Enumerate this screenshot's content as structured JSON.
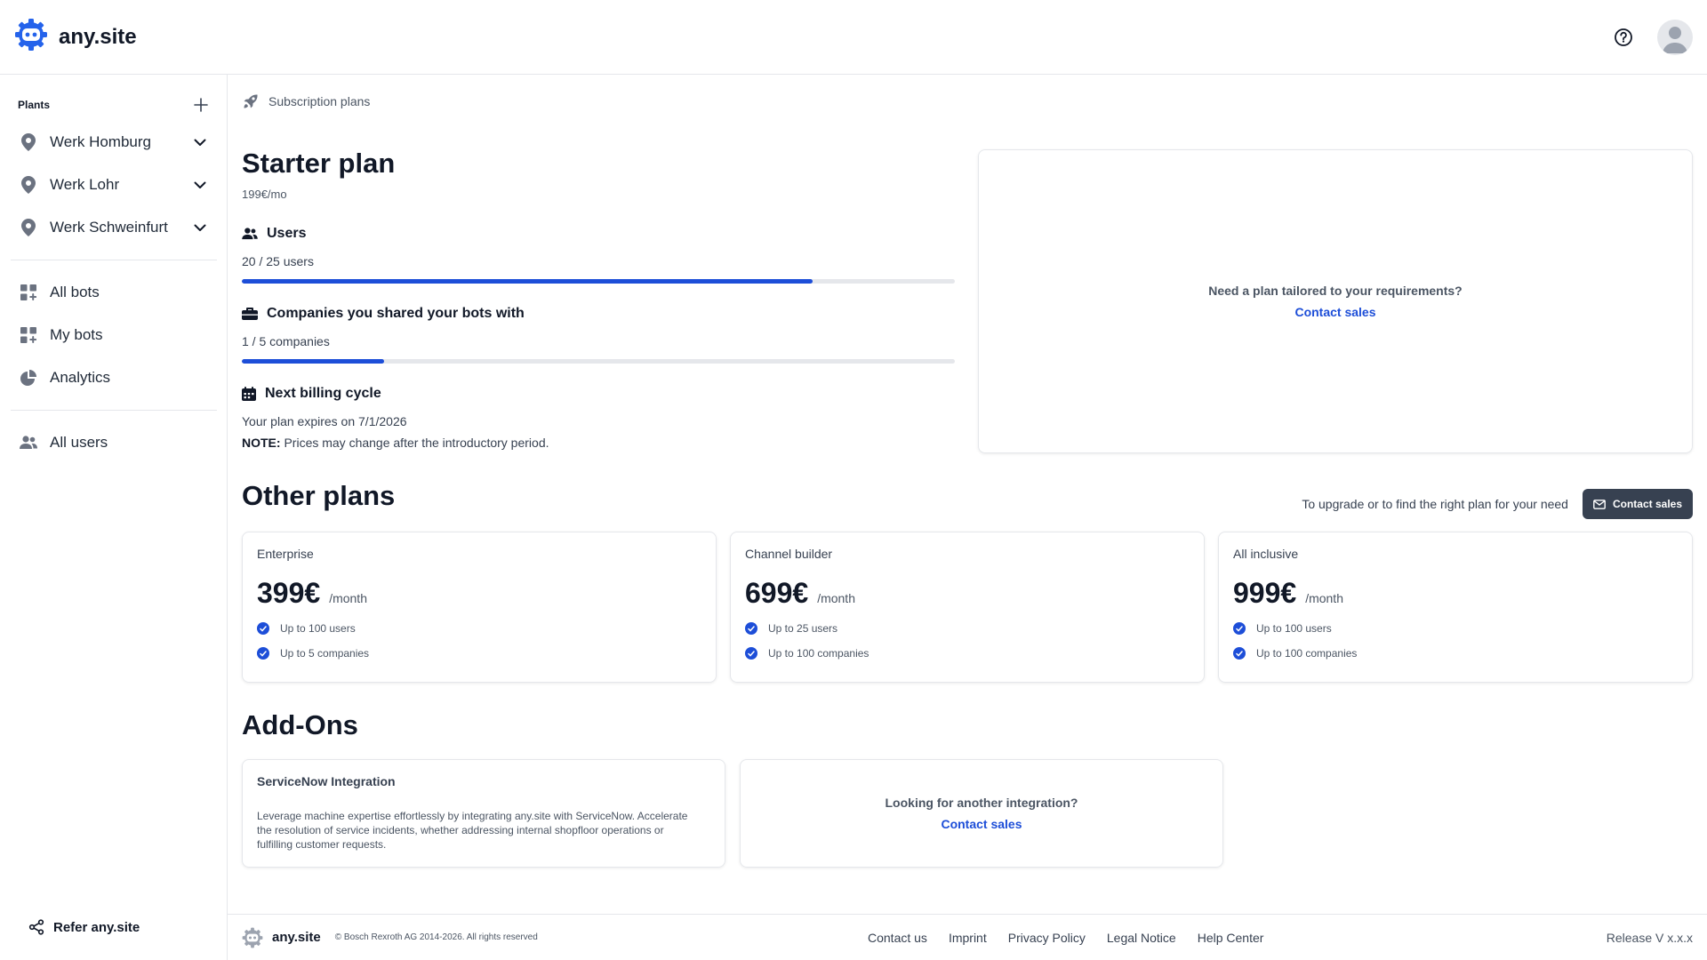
{
  "app": {
    "brand_name": "any.site",
    "accent_color": "#1d4ed8",
    "brand_icon_color": "#2563eb"
  },
  "topbar": {
    "help_icon": "question-circle-icon",
    "avatar_icon": "user-avatar-icon"
  },
  "sidebar": {
    "plants_title": "Plants",
    "plants": [
      {
        "label": "Werk Homburg",
        "icon": "map-pin-icon"
      },
      {
        "label": "Werk Lohr",
        "icon": "map-pin-icon"
      },
      {
        "label": "Werk Schweinfurt",
        "icon": "map-pin-icon"
      }
    ],
    "nav": [
      {
        "label": "All bots",
        "icon": "grid-plus-icon"
      },
      {
        "label": "My bots",
        "icon": "grid-plus-icon"
      },
      {
        "label": "Analytics",
        "icon": "pie-chart-icon"
      }
    ],
    "users": {
      "label": "All users",
      "icon": "users-icon"
    },
    "refer_label": "Refer any.site"
  },
  "breadcrumb": {
    "label": "Subscription plans",
    "icon": "rocket-icon"
  },
  "current_plan": {
    "title": "Starter plan",
    "price": "199€/mo",
    "users": {
      "title": "Users",
      "value": "20 / 25 users",
      "progress": 0.8
    },
    "companies": {
      "title": "Companies you shared your bots with",
      "value": "1 / 5 companies",
      "progress": 0.2
    },
    "billing": {
      "title": "Next billing cycle",
      "expires": "Your plan expires on 7/1/2026",
      "note_label": "NOTE:",
      "note_text": " Prices may change after the introductory period."
    }
  },
  "tailored": {
    "question": "Need a plan tailored to your requirements?",
    "link": "Contact sales"
  },
  "other_plans": {
    "title": "Other plans",
    "upgrade_text": "To upgrade or to find the right plan for your need",
    "contact_button": "Contact sales",
    "plans": [
      {
        "name": "Enterprise",
        "price": "399€",
        "period": "/month",
        "features": [
          "Up to 100 users",
          "Up to 5 companies"
        ]
      },
      {
        "name": "Channel builder",
        "price": "699€",
        "period": "/month",
        "features": [
          "Up to 25 users",
          "Up to 100 companies"
        ]
      },
      {
        "name": "All inclusive",
        "price": "999€",
        "period": "/month",
        "features": [
          "Up to 100 users",
          "Up to 100 companies"
        ]
      }
    ]
  },
  "addons": {
    "title": "Add-Ons",
    "items": [
      {
        "name": "ServiceNow Integration",
        "description": "Leverage machine expertise effortlessly by integrating any.site with ServiceNow. Accelerate the resolution of service incidents, whether addressing internal shopfloor operations or fulfilling customer requests."
      }
    ],
    "other": {
      "question": "Looking for another integration?",
      "link": "Contact sales"
    }
  },
  "footer": {
    "brand": "any.site",
    "copyright": "© Bosch Rexroth AG 2014-2026. All rights reserved",
    "links": [
      "Contact us",
      "Imprint",
      "Privacy Policy",
      "Legal Notice",
      "Help Center"
    ],
    "release": "Release V x.x.x"
  }
}
